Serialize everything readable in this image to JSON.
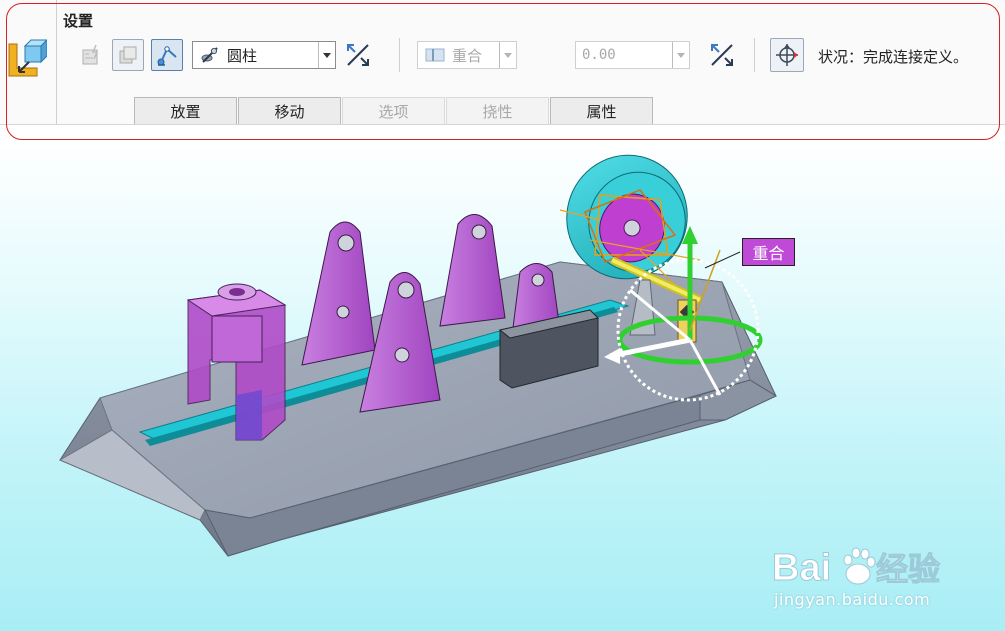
{
  "ribbon": {
    "group_title": "设置",
    "type_dropdown": {
      "value": "圆柱",
      "icon": "cylinder-joint-icon"
    },
    "constraint_dropdown": {
      "value": "重合",
      "icon": "coincident-icon"
    },
    "offset_input": {
      "value": "0.00"
    },
    "status_text": "状况：完成连接定义。"
  },
  "tabs": [
    {
      "label": "放置",
      "enabled": true
    },
    {
      "label": "移动",
      "enabled": true
    },
    {
      "label": "选项",
      "enabled": false
    },
    {
      "label": "挠性",
      "enabled": false
    },
    {
      "label": "属性",
      "enabled": true
    }
  ],
  "viewport": {
    "constraint_label": "重合",
    "label_color": "#c04ad8"
  },
  "watermark": {
    "logo_text": "Bai du 经验",
    "url": "jingyan.baidu.com"
  },
  "colors": {
    "outline_red": "#d82020",
    "model_gray": "#9aa3b2",
    "part_purple": "#b044c8",
    "slot_cyan": "#1fc7d4",
    "wheel_cyan": "#2cc6d0"
  }
}
